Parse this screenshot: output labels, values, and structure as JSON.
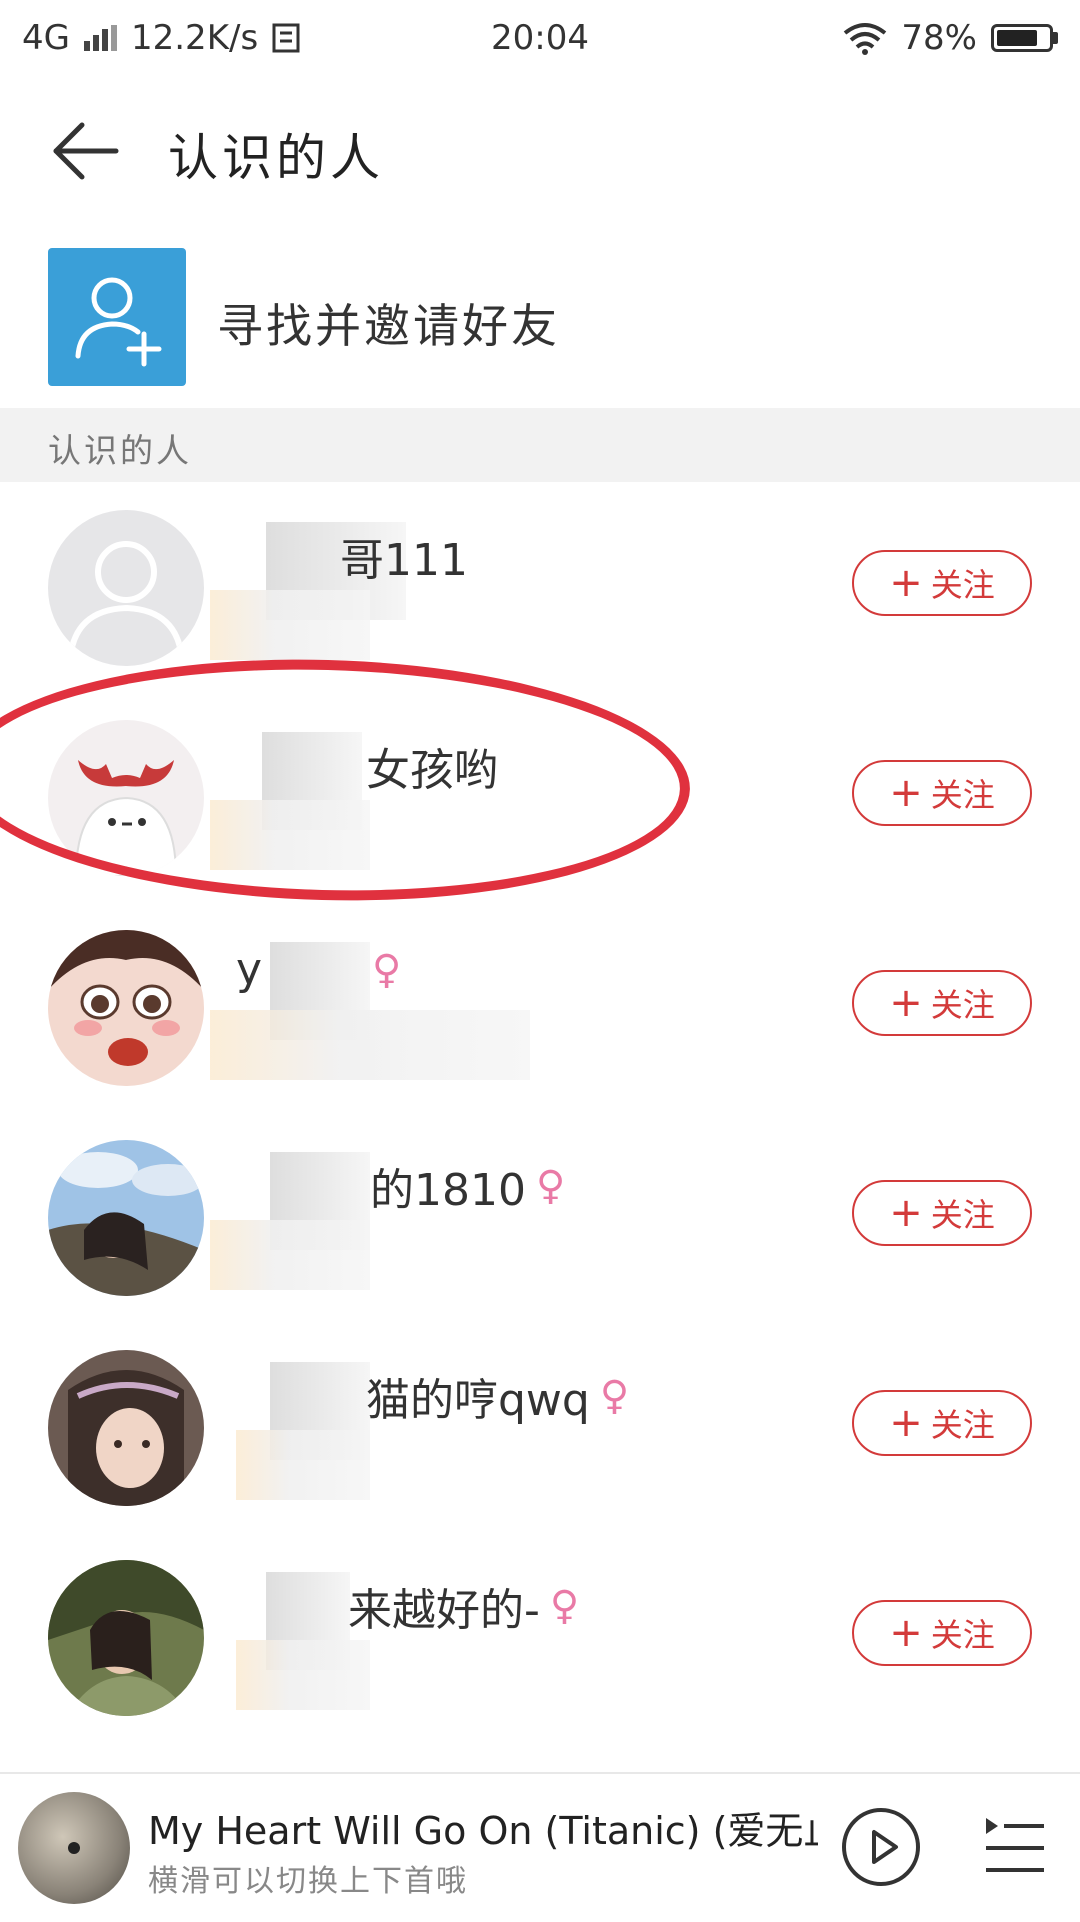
{
  "status_bar": {
    "network": "4G",
    "speed": "12.2K/s",
    "time": "20:04",
    "battery": "78%",
    "icons": [
      "signal-icon",
      "data-saver-icon",
      "wifi-icon",
      "battery-icon"
    ]
  },
  "header": {
    "title": "认识的人",
    "back_icon": "back-arrow-icon"
  },
  "invite": {
    "label": "寻找并邀请好友",
    "icon": "add-user-icon",
    "icon_color": "#3a9fd8"
  },
  "section": {
    "title": "认识的人"
  },
  "people": [
    {
      "name": "哥111",
      "gender_icon": "",
      "follow_label": "关注"
    },
    {
      "name": "女孩哟",
      "gender_icon": "",
      "follow_label": "关注"
    },
    {
      "name": "y",
      "gender_icon": "female-icon",
      "follow_label": "关注"
    },
    {
      "name": "的1810",
      "gender_icon": "female-icon",
      "follow_label": "关注"
    },
    {
      "name": "猫的哼qwq",
      "gender_icon": "female-icon",
      "follow_label": "关注"
    },
    {
      "name": "来越好的-",
      "gender_icon": "female-icon",
      "follow_label": "关注"
    }
  ],
  "follow": {
    "plus": "+",
    "color": "#d33a3a"
  },
  "player": {
    "song_title": "My Heart Will Go On (Titanic) (爱无止",
    "hint": "横滑可以切换上下首哦",
    "play_icon": "play-icon",
    "playlist_icon": "playlist-icon"
  },
  "colors": {
    "highlight": "#e0313e",
    "female": "#e97aa6"
  }
}
